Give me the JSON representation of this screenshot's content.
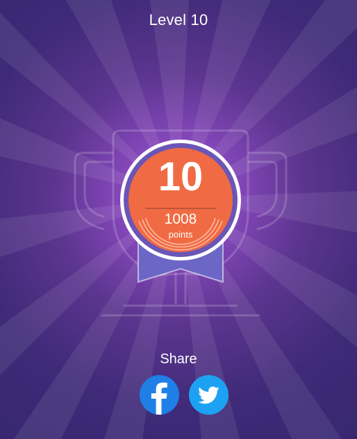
{
  "header": {
    "title": "Level 10"
  },
  "badge": {
    "level": "10",
    "points_value": "1008",
    "points_label": "points"
  },
  "share": {
    "label": "Share",
    "buttons": [
      {
        "icon": "facebook-icon",
        "color": "#1f7fe6"
      },
      {
        "icon": "twitter-icon",
        "color": "#1da1f2"
      }
    ]
  },
  "colors": {
    "background_center": "#a45fcf",
    "background_edge": "#372770",
    "medal_fill": "#f06b43",
    "medal_ring": "#6b55b6",
    "ribbon": "#6c66c6"
  }
}
